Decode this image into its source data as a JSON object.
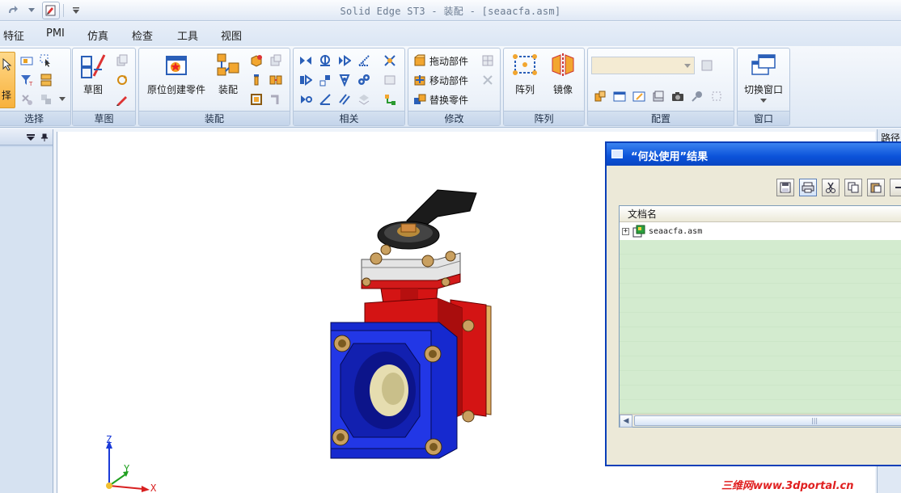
{
  "window": {
    "title": "Solid Edge ST3 - 装配 - [seaacfa.asm]"
  },
  "menu_tabs": [
    "特征",
    "PMI",
    "仿真",
    "检查",
    "工具",
    "视图"
  ],
  "ribbon": {
    "select_group": {
      "big_label": "择",
      "label": "选择"
    },
    "sketch_group": {
      "big_label": "草图",
      "label": "草图"
    },
    "assembly_group": {
      "create_in_place_label": "原位创建零件",
      "assemble_label": "装配",
      "label": "装配"
    },
    "related_group": {
      "label": "相关"
    },
    "modify_group": {
      "drag_part": "拖动部件",
      "move_part": "移动部件",
      "replace_part": "替换零件",
      "label": "修改"
    },
    "pattern_group": {
      "pattern_label": "阵列",
      "mirror_label": "镜像",
      "label": "阵列"
    },
    "config_group": {
      "label": "配置"
    },
    "window_group": {
      "switch_window_label": "切换窗口",
      "label": "窗口"
    }
  },
  "right_pane": {
    "tab_label": "路径"
  },
  "dialog": {
    "title": "“何处使用”结果",
    "column_header": "文档名",
    "rows": [
      {
        "name": "seaacfa.asm",
        "expander": "+"
      }
    ]
  },
  "axes": {
    "z": "Z",
    "y": "Y",
    "x": "X"
  },
  "watermark": "三维网www.3dportal.cn",
  "colors": {
    "accent": "#0a46c2",
    "valve_body": "#d41414",
    "flange": "#1a2dd8",
    "list_bg": "#cfe8c9"
  }
}
